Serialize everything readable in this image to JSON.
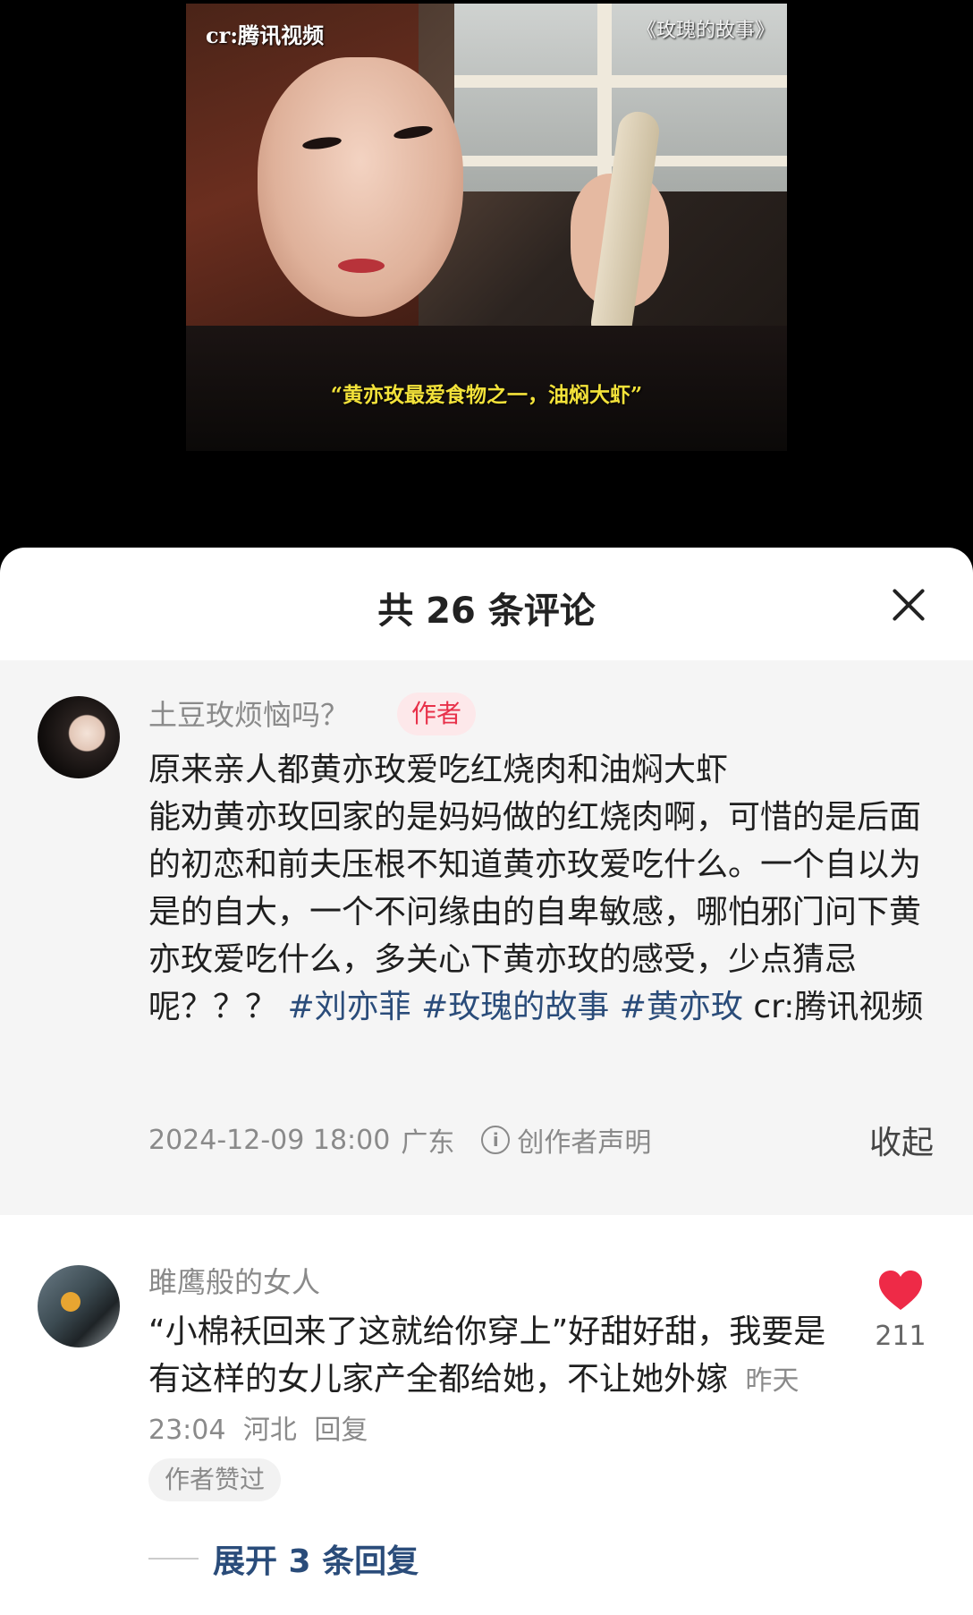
{
  "video": {
    "watermark_left": "cr:腾讯视频",
    "watermark_right": "《玫瑰的故事》",
    "subtitle": "“黄亦玫最爱食物之一，油焖大虾”"
  },
  "sheet": {
    "title": "共 26 条评论"
  },
  "author_post": {
    "username": "土豆玫烦恼吗？",
    "badge": "作者",
    "text_lines": [
      "原来亲人都黄亦玫爱吃红烧肉和油焖大虾",
      "能劝黄亦玫回家的是妈妈做的红烧肉啊，可惜的是后面的初恋和前夫压根不知道黄亦玫爱吃什么。一个自以为是的自大，一个不问缘由的自卑敏感，哪怕邪门问下黄亦玫爱吃什么，多关心下黄亦玫的感受，少点猜忌呢？？？"
    ],
    "tags": [
      "#刘亦菲",
      "#玫瑰的故事",
      "#黄亦玫"
    ],
    "credit": "cr:腾讯视频",
    "datetime": "2024-12-09 18:00",
    "location": "广东",
    "statement": "创作者声明",
    "collapse": "收起"
  },
  "comment": {
    "username": "雎鹰般的女人",
    "text": "“小棉袄回来了这就给你穿上”好甜好甜，我要是有这样的女儿家产全都给她，不让她外嫁",
    "time": "昨天 23:04",
    "location": "河北",
    "reply": "回复",
    "author_liked": "作者赞过",
    "likes": "211",
    "expand_replies": "展开 3 条回复"
  },
  "colors": {
    "accent_red": "#ee2a47",
    "tag_blue": "#2a4c7a",
    "badge_bg": "#fde8ea"
  }
}
